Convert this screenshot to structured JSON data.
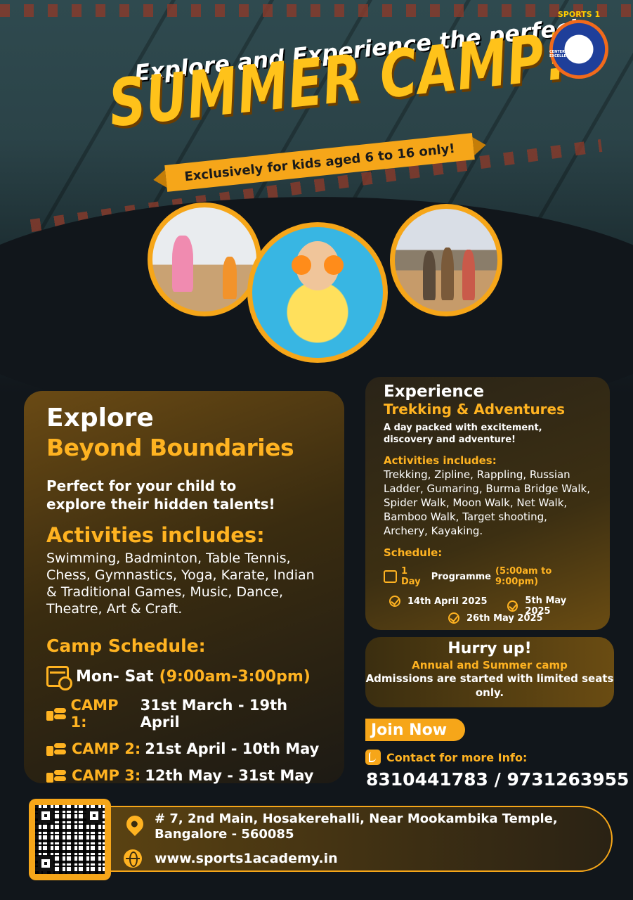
{
  "header": {
    "tagline": "Explore and Experience the perfect",
    "title": "SUMMER CAMP!",
    "ribbon": "Exclusively for kids aged 6 to 16 only!",
    "logo_text": "SPORTS 1",
    "logo_subtext": "CENTER FOR SPORTS EXCELLENCE"
  },
  "explore": {
    "title_line1": "Explore",
    "title_line2": "Beyond Boundaries",
    "intro": "Perfect for your child to explore their hidden talents!",
    "activities_heading": "Activities includes:",
    "activities": "Swimming, Badminton, Table Tennis, Chess, Gymnastics, Yoga, Karate, Indian & Traditional Games, Music, Dance, Theatre, Art & Craft.",
    "schedule_heading": "Camp Schedule:",
    "schedule_days": "Mon- Sat",
    "schedule_hours": "(9:00am-3:00pm)",
    "camps": [
      {
        "label": "CAMP 1:",
        "dates": "31st March - 19th April"
      },
      {
        "label": "CAMP 2:",
        "dates": "21st April - 10th May"
      },
      {
        "label": "CAMP 3:",
        "dates": "12th May - 31st May"
      }
    ]
  },
  "trekking": {
    "title_line1": "Experience",
    "title_line2": "Trekking & Adventures",
    "intro": "A day packed with excitement, discovery and adventure!",
    "activities_heading": "Activities includes:",
    "activities": "Trekking,  Zipline, Rappling, Russian Ladder, Gumaring, Burma Bridge Walk, Spider Walk, Moon Walk, Net Walk, Bamboo Walk, Target shooting, Archery, Kayaking.",
    "schedule_heading": "Schedule:",
    "programme_days": "1 Day",
    "programme_word": "Programme",
    "programme_hours": "(5:00am to 9:00pm)",
    "dates": [
      "14th April 2025",
      "5th May 2025",
      "26th May 2025"
    ]
  },
  "hurry": {
    "heading": "Hurry up!",
    "subheading": "Annual and Summer camp",
    "text": "Admissions are started with limited seats only."
  },
  "contact": {
    "join_label": "Join Now",
    "info_label": "Contact for more Info:",
    "phones": "8310441783 / 9731263955",
    "address": "# 7, 2nd Main, Hosakerehalli, Near Mookambika Temple, Bangalore - 560085",
    "website": "www.sports1academy.in"
  },
  "colors": {
    "accent": "#f6a619",
    "heading_gold": "#ffb321",
    "background": "#11161b"
  }
}
